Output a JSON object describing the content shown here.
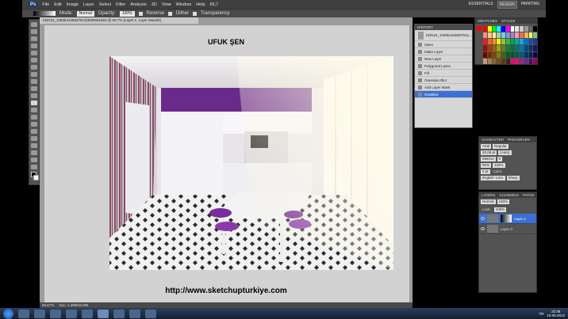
{
  "menu": {
    "logo": "Ps",
    "items": [
      "File",
      "Edit",
      "Image",
      "Layer",
      "Select",
      "Filter",
      "Analysis",
      "3D",
      "View",
      "Window",
      "Help"
    ],
    "zoom": "66,7",
    "workspaces": [
      "ESSENTIALS",
      "DESIGN",
      "PAINTING"
    ]
  },
  "options": {
    "mode_label": "Mode:",
    "mode": "Normal",
    "opacity_label": "Opacity:",
    "opacity": "100%",
    "reverse": "Reverse",
    "dither": "Dither",
    "transparency": "Transparency"
  },
  "document": {
    "tab": "KDN24_1090b4108837611fd0090d1653 @ 66,7% (Layer 1, Layer Mask/8)",
    "zoom": "66,67%",
    "doc_size": "Doc: 1,48M/16,9M",
    "title": "UFUK ŞEN",
    "url": "http://www.sketchupturkiye.com"
  },
  "history": {
    "tab": "HISTORY",
    "snapshot": "KDN24_1090b4108837611...",
    "items": [
      "Open",
      "Make Layer",
      "New Layer",
      "Polygonal Lasso",
      "Fill",
      "Gaussian Blur",
      "Add Layer Mask",
      "Gradient"
    ],
    "selected": 7
  },
  "color": {
    "tabs": [
      "SWATCHES",
      "STYLES"
    ],
    "swatches": [
      "#ff0000",
      "#ffff00",
      "#00ff00",
      "#00ffff",
      "#0000ff",
      "#ff00ff",
      "#ffffff",
      "#e6e6e6",
      "#cccccc",
      "#999999",
      "#666666",
      "#000000",
      "#f7977a",
      "#fdc68a",
      "#fff79a",
      "#a2d39c",
      "#6ecff6",
      "#8493ca",
      "#a187be",
      "#f49ac2",
      "#f26c4f",
      "#fbaf5d",
      "#fff568",
      "#7cc576",
      "#ed1c24",
      "#f26522",
      "#f7941d",
      "#fff200",
      "#8dc63f",
      "#39b54a",
      "#00a651",
      "#00a99d",
      "#00aeef",
      "#0072bc",
      "#0054a6",
      "#2e3192",
      "#9e0b0f",
      "#a0410d",
      "#a36209",
      "#aba000",
      "#598527",
      "#1a7b30",
      "#007236",
      "#00746b",
      "#0076a3",
      "#004b80",
      "#003471",
      "#1b1464",
      "#790000",
      "#7b2e00",
      "#7d4900",
      "#827b00",
      "#406618",
      "#005e20",
      "#005826",
      "#005952",
      "#005b7f",
      "#003663",
      "#002157",
      "#0d004c",
      "#c69c6d",
      "#a67c52",
      "#8c6239",
      "#754c24",
      "#603913",
      "#3c2415",
      "#ec008c",
      "#ed145b",
      "#92278f",
      "#662d91",
      "#440e62",
      "#9e005d"
    ]
  },
  "character": {
    "tabs": [
      "CHARACTER",
      "PARAGRAPH"
    ],
    "font": "Arial",
    "style": "Regular",
    "size": "20,08 pt",
    "leading": "(Auto)",
    "kerning": "Metrics",
    "tracking": "0",
    "vscale": "90%",
    "hscale": "120%",
    "baseline": "0 pt",
    "color_label": "Color:",
    "language": "English: USA",
    "aa": "Sharp"
  },
  "layers": {
    "tabs": [
      "LAYERS",
      "CHANNELS",
      "PATHS"
    ],
    "mode": "Normal",
    "opacity": "100%",
    "lock_label": "Lock:",
    "fill": "100%",
    "items": [
      {
        "name": "Layer 1",
        "selected": true
      },
      {
        "name": "Layer 0",
        "selected": false
      }
    ]
  },
  "taskbar": {
    "lang": "TR",
    "time": "22:36",
    "date": "10.06.2012"
  },
  "photo": {
    "wall_color": "#e8e4ea",
    "cabinet_color": "#6a2a8a",
    "floor_dark": "#2b2b2b",
    "light_color": "#fffbe8"
  }
}
